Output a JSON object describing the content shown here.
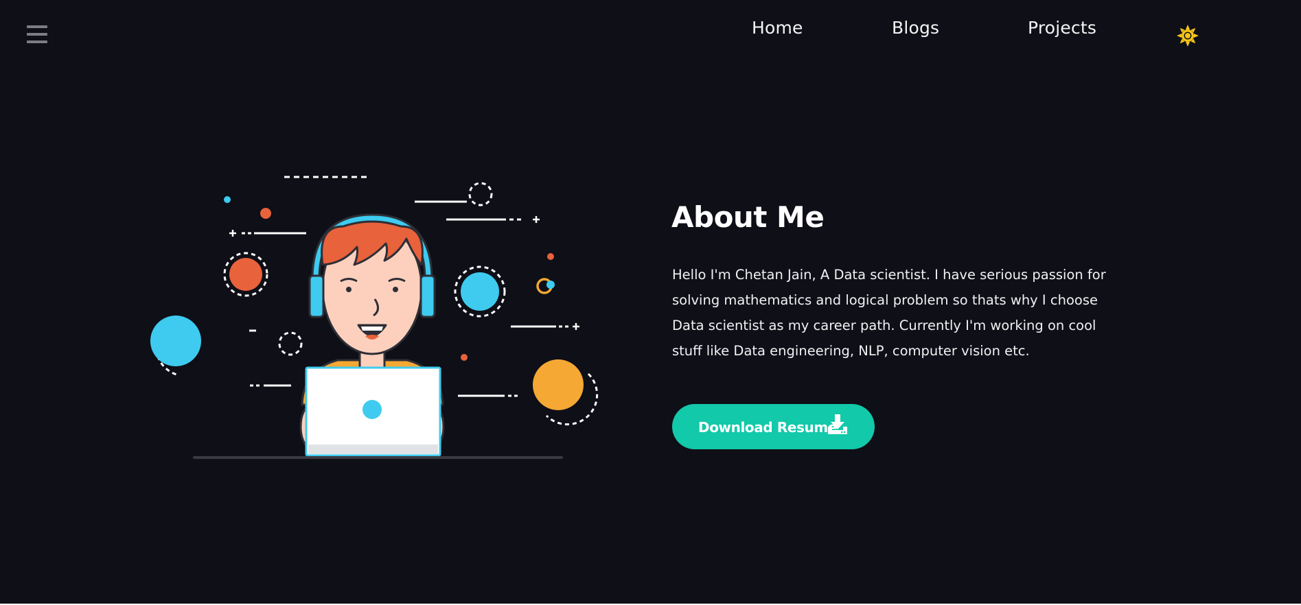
{
  "nav": {
    "menu_icon": "hamburger-menu-icon",
    "links": {
      "home": "Home",
      "blogs": "Blogs",
      "projects": "Projects"
    },
    "theme_icon": "sun-icon"
  },
  "about": {
    "title": "About Me",
    "description": "Hello I'm Chetan Jain, A Data scientist. I have serious passion for solving mathematics and logical problem so thats why I choose Data scientist as my career path. Currently I'm working on cool stuff like Data engineering, NLP, computer vision etc.",
    "button_label": "Download Resume",
    "button_icon": "download-icon"
  },
  "colors": {
    "background": "#0f0f17",
    "accent": "#12c9a9",
    "sun": "#f5c518",
    "cyan": "#3ecbef",
    "orange": "#e8623c",
    "yellow": "#f5a833"
  }
}
